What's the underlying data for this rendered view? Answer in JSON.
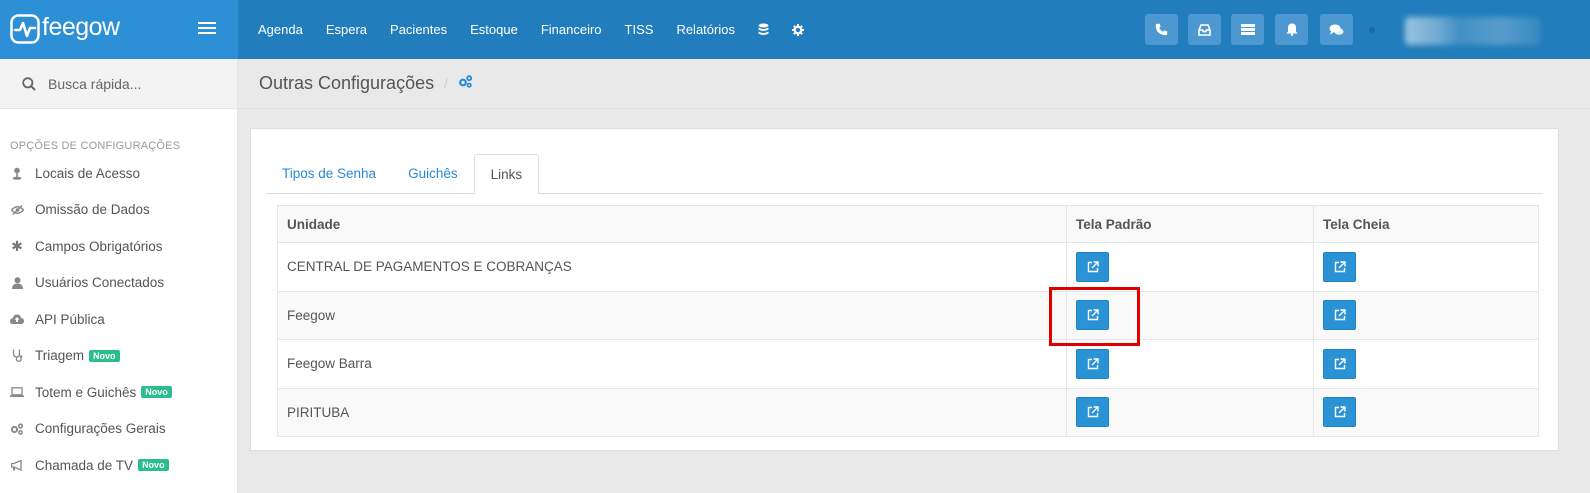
{
  "brand": {
    "name": "feegow"
  },
  "nav": {
    "items": [
      "Agenda",
      "Espera",
      "Pacientes",
      "Estoque",
      "Financeiro",
      "TISS",
      "Relatórios"
    ],
    "icons": [
      "database-icon",
      "gear-icon"
    ]
  },
  "topbar": {
    "buttons": [
      "phone-icon",
      "inbox-icon",
      "list-icon",
      "bell-icon",
      "chat-icon"
    ]
  },
  "search": {
    "placeholder": "Busca rápida..."
  },
  "sidebar": {
    "header": "OPÇÕES DE CONFIGURAÇÕES",
    "items": [
      {
        "label": "Locais de Acesso",
        "icon": "map-pin-icon"
      },
      {
        "label": "Omissão de Dados",
        "icon": "eye-slash-icon"
      },
      {
        "label": "Campos Obrigatórios",
        "icon": "asterisk-icon"
      },
      {
        "label": "Usuários Conectados",
        "icon": "user-icon"
      },
      {
        "label": "API Pública",
        "icon": "cloud-upload-icon"
      },
      {
        "label": "Triagem",
        "icon": "stethoscope-icon",
        "badge": "Novo"
      },
      {
        "label": "Totem e Guichês",
        "icon": "laptop-icon",
        "badge": "Novo"
      },
      {
        "label": "Configurações Gerais",
        "icon": "cogs-icon"
      },
      {
        "label": "Chamada de TV",
        "icon": "bullhorn-icon",
        "badge": "Novo"
      }
    ]
  },
  "page": {
    "title": "Outras Configurações",
    "breadcrumb_sep": "/",
    "breadcrumb_icon": "cogs-icon"
  },
  "tabs": [
    {
      "label": "Tipos de Senha",
      "active": false
    },
    {
      "label": "Guichês",
      "active": false
    },
    {
      "label": "Links",
      "active": true
    }
  ],
  "table": {
    "headers": [
      "Unidade",
      "Tela Padrão",
      "Tela Cheia"
    ],
    "rows": [
      {
        "unidade": "CENTRAL DE PAGAMENTOS E COBRANÇAS"
      },
      {
        "unidade": "Feegow"
      },
      {
        "unidade": "Feegow Barra"
      },
      {
        "unidade": "PIRITUBA"
      }
    ]
  },
  "colors": {
    "topbar": "#217dbb",
    "brand": "#2d8fd5",
    "accent": "#2a93d6",
    "badge": "#2bbe8d",
    "highlight": "#e00000"
  }
}
